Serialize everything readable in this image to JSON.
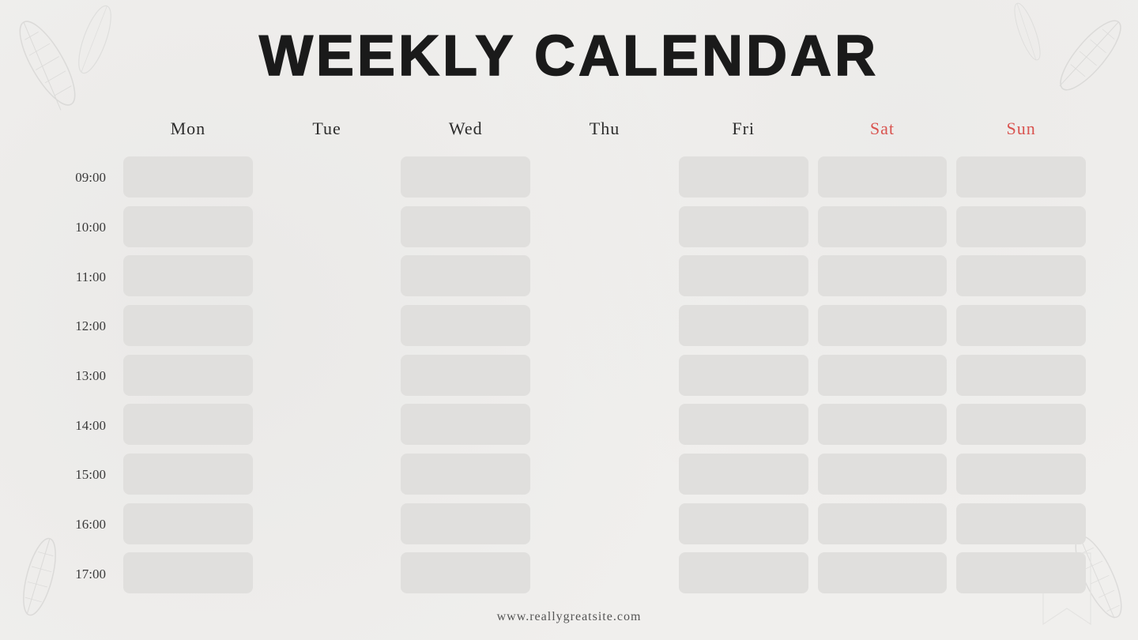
{
  "title": "WEEKLY CALENDAR",
  "days": [
    {
      "label": "Mon",
      "weekend": false
    },
    {
      "label": "Tue",
      "weekend": false
    },
    {
      "label": "Wed",
      "weekend": false
    },
    {
      "label": "Thu",
      "weekend": false
    },
    {
      "label": "Fri",
      "weekend": false
    },
    {
      "label": "Sat",
      "weekend": true
    },
    {
      "label": "Sun",
      "weekend": true
    }
  ],
  "times": [
    "09:00",
    "10:00",
    "11:00",
    "12:00",
    "13:00",
    "14:00",
    "15:00",
    "16:00",
    "17:00"
  ],
  "footer": "www.reallygreatsite.com",
  "slot_columns": [
    true,
    false,
    true,
    false,
    true,
    false,
    true
  ],
  "colors": {
    "slot_bg": "#e0dfdd",
    "weekend_color": "#d9534f",
    "regular_day_color": "#2c2c2c",
    "bg": "#f0efed",
    "time_color": "#3a3a3a",
    "footer_color": "#555555",
    "title_color": "#1a1a1a"
  }
}
